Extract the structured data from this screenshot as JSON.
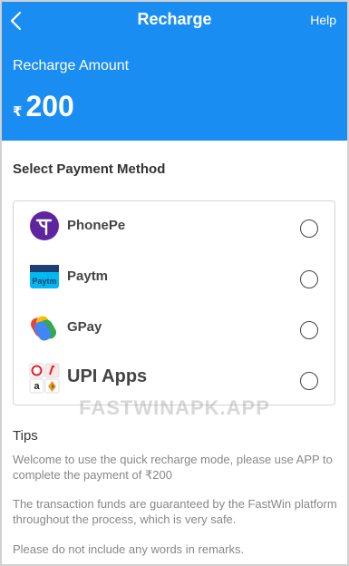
{
  "header": {
    "title": "Recharge",
    "help_label": "Help",
    "amount_label": "Recharge Amount",
    "currency_symbol": "₹",
    "amount": "200",
    "background_color": "#1a8df3"
  },
  "payment": {
    "section_title": "Select Payment Method",
    "methods": [
      {
        "label": "PhonePe",
        "icon": "phonepe-icon",
        "selected": false
      },
      {
        "label": "Paytm",
        "icon": "paytm-icon",
        "selected": false
      },
      {
        "label": "GPay",
        "icon": "gpay-icon",
        "selected": false
      },
      {
        "label": "UPI Apps",
        "icon": "upi-apps-icon",
        "selected": false
      }
    ]
  },
  "watermark": "FASTWINAPK.APP",
  "tips": {
    "title": "Tips",
    "items": [
      "Welcome to use the quick recharge mode, please use APP to complete the payment of ₹200",
      "The transaction funds are guaranteed by the FastWin platform throughout the process, which is very safe.",
      "Please do not include any words in remarks."
    ]
  }
}
